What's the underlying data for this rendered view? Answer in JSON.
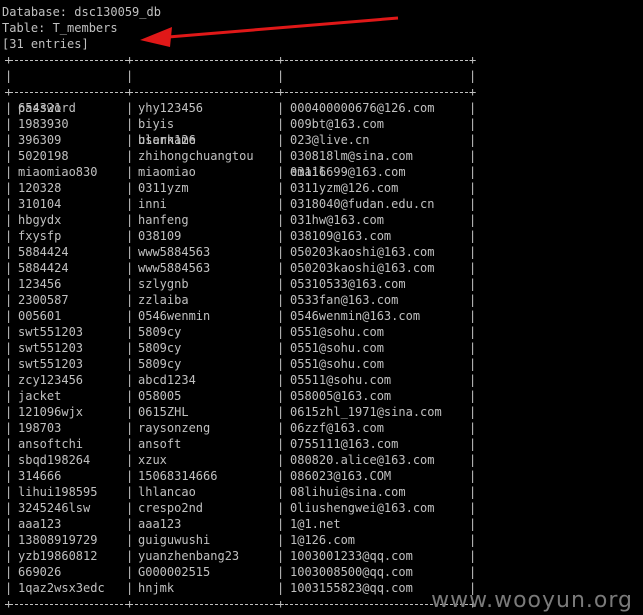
{
  "header": {
    "database_line": "Database: dsc130059_db",
    "table_line": "Table: T_members",
    "entries_line": "[31 entries]"
  },
  "table": {
    "columns": [
      "password",
      "username",
      "email"
    ],
    "rows": [
      [
        "654321",
        "yhy123456",
        "000400000676@126.com"
      ],
      [
        "1983930",
        "biyis",
        "009bt@163.com"
      ],
      [
        "396309",
        "blank126",
        "023@live.cn"
      ],
      [
        "5020198",
        "zhihongchuangtou",
        "030818lm@sina.com"
      ],
      [
        "miaomiao830",
        "miaomiao",
        "03116699@163.com"
      ],
      [
        "120328",
        "0311yzm",
        "0311yzm@126.com"
      ],
      [
        "310104",
        "inni",
        "0318040@fudan.edu.cn"
      ],
      [
        "hbgydx",
        "hanfeng",
        "031hw@163.com"
      ],
      [
        "fxysfp",
        "038109",
        "038109@163.com"
      ],
      [
        "5884424",
        "www5884563",
        "050203kaoshi@163.com"
      ],
      [
        "5884424",
        "www5884563",
        "050203kaoshi@163.com"
      ],
      [
        "123456",
        "szlygnb",
        "05310533@163.com"
      ],
      [
        "2300587",
        "zzlaiba",
        "0533fan@163.com"
      ],
      [
        "005601",
        "0546wenmin",
        "0546wenmin@163.com"
      ],
      [
        "swt551203",
        "5809cy",
        "0551@sohu.com"
      ],
      [
        "swt551203",
        "5809cy",
        "0551@sohu.com"
      ],
      [
        "swt551203",
        "5809cy",
        "0551@sohu.com"
      ],
      [
        "zcy123456",
        "abcd1234",
        "05511@sohu.com"
      ],
      [
        "jacket",
        "058005",
        "058005@163.com"
      ],
      [
        "121096wjx",
        "0615ZHL",
        "0615zhl_1971@sina.com"
      ],
      [
        "198703",
        "raysonzeng",
        "06zzf@163.com"
      ],
      [
        "ansoftchi",
        "ansoft",
        "0755111@163.com"
      ],
      [
        "sbqd198264",
        "xzux",
        "080820.alice@163.com"
      ],
      [
        "314666",
        "15068314666",
        "086023@163.COM"
      ],
      [
        "lihui198595",
        "lhlancao",
        "08lihui@sina.com"
      ],
      [
        "3245246lsw",
        "crespo2nd",
        "0liushengwei@163.com"
      ],
      [
        "aaa123",
        "aaa123",
        "1@1.net"
      ],
      [
        "13808919729",
        "guiguwushi",
        "1@126.com"
      ],
      [
        "yzb19860812",
        "yuanzhenbang23",
        "1003001233@qq.com"
      ],
      [
        "669026",
        "G000002515",
        "1003008500@qq.com"
      ],
      [
        "1qaz2wsx3edc",
        "hnjmk",
        "1003155823@qq.com"
      ]
    ]
  },
  "watermark": "www.wooyun.org",
  "colors": {
    "background": "#000000",
    "text": "#c0c0c0",
    "arrow": "#e01818"
  }
}
